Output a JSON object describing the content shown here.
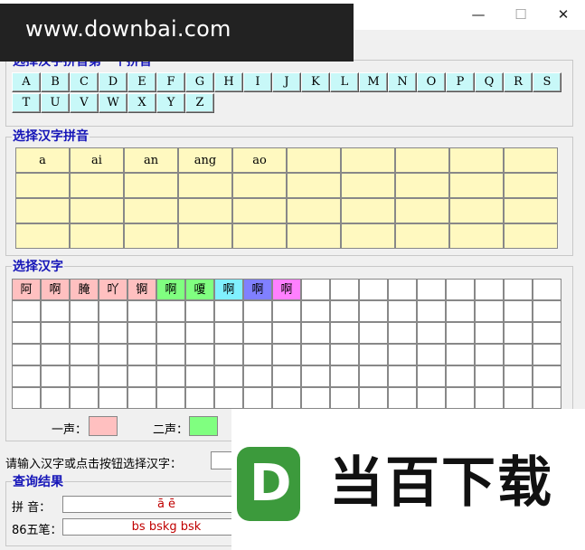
{
  "window": {
    "minimize": "—",
    "maximize": "☐",
    "close": "✕"
  },
  "watermark_top": "www.downbai.com",
  "letter_group": {
    "title": "选择汉字拼音第一个拼音",
    "letters": [
      "A",
      "B",
      "C",
      "D",
      "E",
      "F",
      "G",
      "H",
      "I",
      "J",
      "K",
      "L",
      "M",
      "N",
      "O",
      "P",
      "Q",
      "R",
      "S",
      "T",
      "U",
      "V",
      "W",
      "X",
      "Y",
      "Z"
    ]
  },
  "pinyin_group": {
    "title": "选择汉字拼音",
    "items": [
      "a",
      "ai",
      "an",
      "ang",
      "ao",
      "",
      "",
      "",
      "",
      "",
      "",
      "",
      "",
      "",
      "",
      "",
      "",
      "",
      "",
      "",
      "",
      "",
      "",
      "",
      "",
      "",
      "",
      "",
      "",
      "",
      "",
      "",
      "",
      "",
      "",
      "",
      "",
      "",
      "",
      ""
    ]
  },
  "hanzi_group": {
    "title": "选择汉字",
    "items": [
      "阿",
      "啊",
      "腌",
      "吖",
      "锕",
      "啊",
      "嗄",
      "啊",
      "啊",
      "啊"
    ],
    "item_colors": [
      "#ffc0c0",
      "#ffc0c0",
      "#ffc0c0",
      "#ffc0c0",
      "#ffc0c0",
      "#80ff80",
      "#80ff80",
      "#80f0ff",
      "#8080ff",
      "#ff80ff"
    ],
    "tone1_label": "一声：",
    "tone2_label": "二声：",
    "tone1_color": "#ffc0c0",
    "tone2_color": "#80ff80"
  },
  "input_row": {
    "label": "请输入汉字或点击按钮选择汉字：",
    "value": ""
  },
  "result_group": {
    "title": "查询结果",
    "pinyin_label": "拼 音：",
    "pinyin_value": "ā  ē",
    "wubi_label": "86五笔：",
    "wubi_value": "bs bskg bsk"
  },
  "watermark_logo": {
    "letter": "D",
    "brand": "当百下载"
  }
}
